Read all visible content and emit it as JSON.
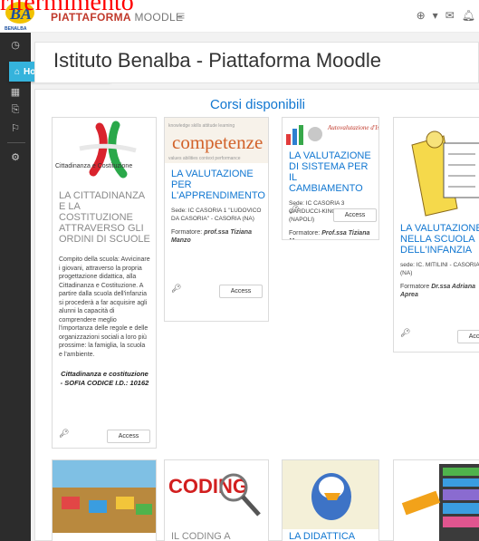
{
  "overlay": {
    "text": "rifermimento"
  },
  "brand": {
    "logo_text": "BENALBA",
    "name_bold": "PIATTAFORMA",
    "name_light": "MOODLE"
  },
  "topbar": {
    "icons": [
      "globe-icon",
      "chevron-down-icon",
      "mail-icon",
      "bell-icon"
    ]
  },
  "sidebar": {
    "home_label": "Home del sito",
    "items": [
      "dashboard-icon",
      "home-icon",
      "calendar-icon",
      "files-icon",
      "graduation-icon",
      "settings-icon"
    ]
  },
  "page": {
    "title": "Istituto Benalba - Piattaforma Moodle"
  },
  "courses": {
    "heading": "Corsi disponibili",
    "access_label": "Access",
    "items": [
      {
        "image_caption": "Cittadinanza e Costituzione",
        "title": "LA CITTADINANZA E LA COSTITUZIONE ATTRAVERSO GLI ORDINI DI SCUOLE",
        "description": "Compito della scuola: Avvicinare i giovani, attraverso la propria progettazione didattica, alla Cittadinanza e Costituzione. A partire dalla scuola dell'infanzia si procederà a far acquisire agli alunni la capacità di comprendere meglio l'importanza delle regole e delle organizzazioni sociali a loro più prossime: la famiglia, la scuola e l'ambiente.",
        "certification": "Cittadinanza e costituzione - SOFIA CODICE I.D.: 10162"
      },
      {
        "image_caption": "competenze",
        "title": "LA VALUTAZIONE PER L'APPRENDIMENTO",
        "meta": "Sede: IC CASORIA 1 \"LUDOVICO DA CASORIA\" - CASORIA (NA)",
        "trainer_prefix": "Formatore: ",
        "trainer_name": "prof.ssa Tiziana Manzo"
      },
      {
        "image_caption": "Autovalutazione d'Istituto",
        "title": "LA VALUTAZIONE DI SISTEMA PER IL CAMBIAMENTO",
        "meta": "Sede: IC CASORIA 3 CARDUCCI-KING - CASORIA (NAPOLI)",
        "trainer_prefix": "Formatore: ",
        "trainer_name": "Prof.ssa Tiziana Manzo"
      },
      {
        "title": "LA VALUTAZIONE NELLA SCUOLA DELL'INFANZIA",
        "meta": "sede: IC. MITILINI - CASORIA (NA)",
        "trainer_prefix": "Formatore ",
        "trainer_name": "Dr.ssa Adriana Aprea"
      },
      {
        "image_caption": ""
      },
      {
        "image_caption": "CODING",
        "title": "IL CODING A"
      },
      {
        "title": "LA DIDATTICA"
      },
      {
        "image_caption": ""
      }
    ]
  },
  "colors": {
    "accent": "#1177d1",
    "brand_red": "#c0392b",
    "sidebar": "#2c2c2c",
    "home_tag": "#35b3dc"
  }
}
